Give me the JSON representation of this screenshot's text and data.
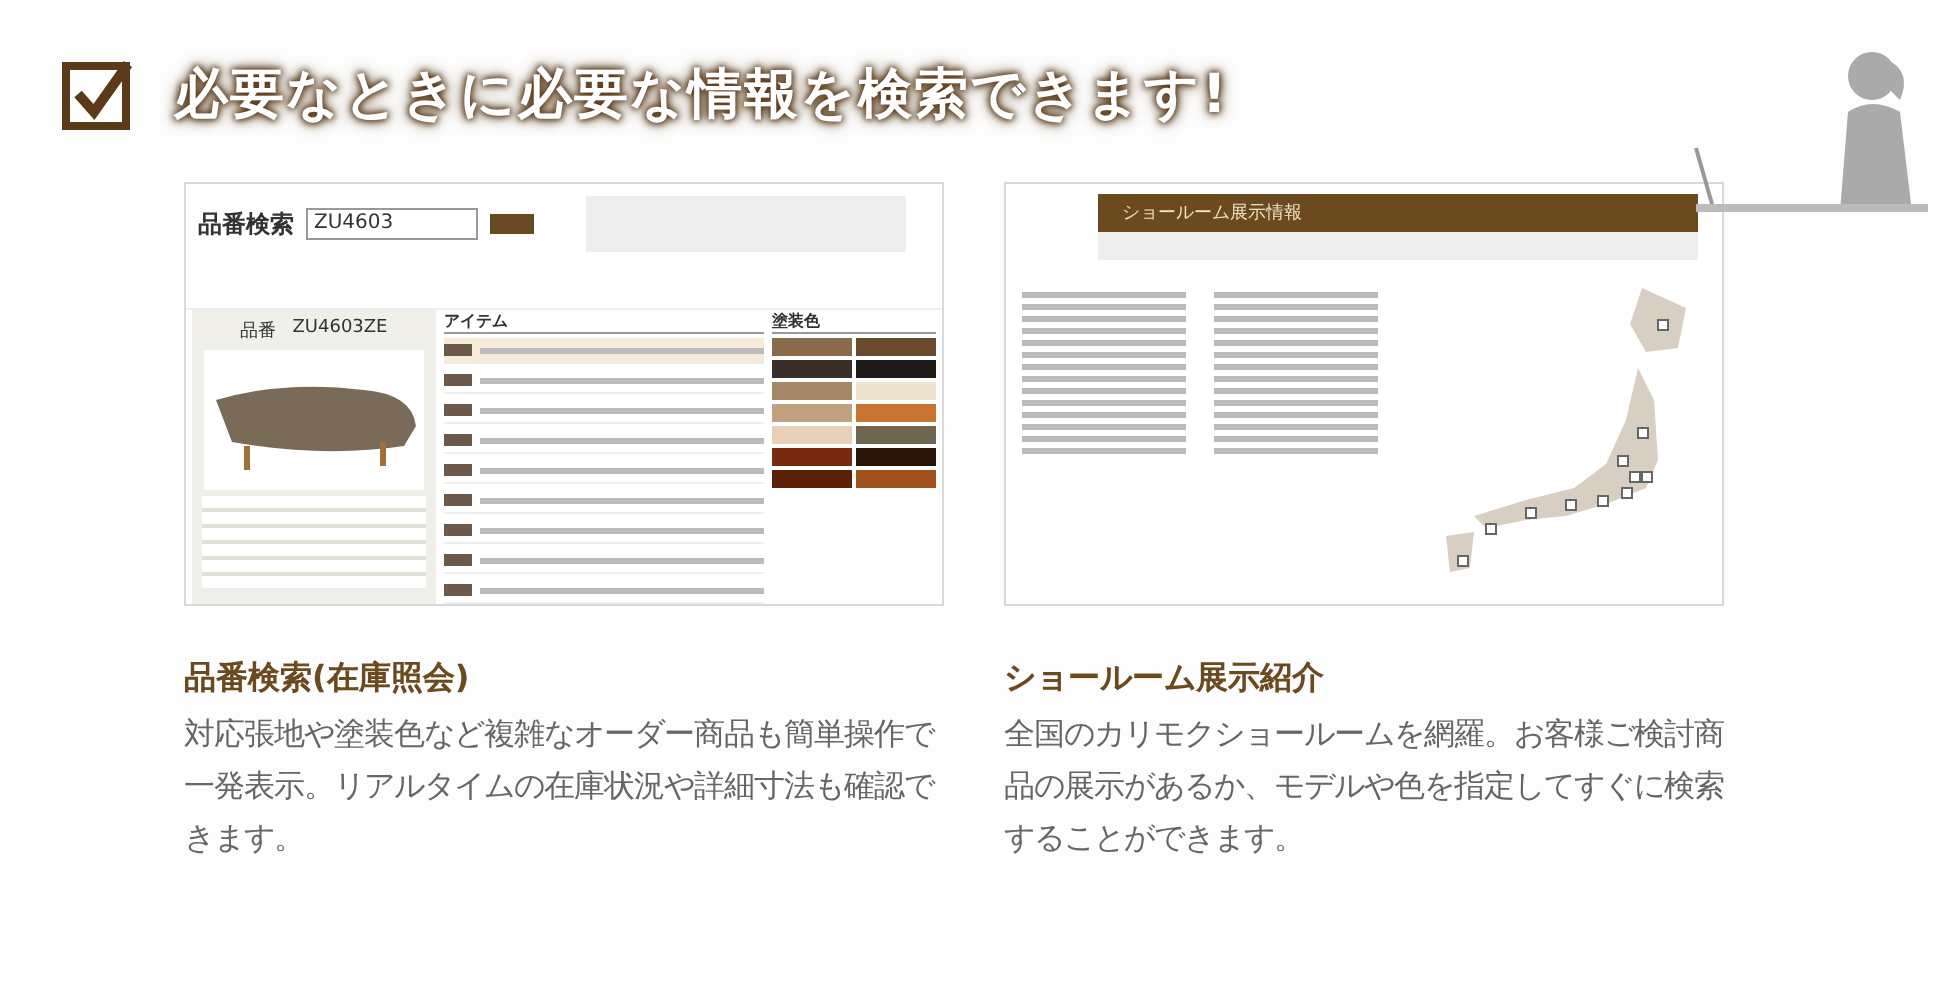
{
  "headline": {
    "checked": true,
    "title": "必要なときに必要な情報を検索できます!"
  },
  "features": [
    {
      "kind": "search",
      "screenshot": {
        "search_label": "品番検索",
        "search_value": "ZU4603",
        "product_label": "品番",
        "product_code": "ZU4603ZE",
        "items_heading": "アイテム",
        "paint_heading": "塗装色"
      },
      "title": "品番検索(在庫照会)",
      "body": "対応張地や塗装色など複雑なオーダー商品も簡単操作で一発表示。リアルタイムの在庫状況や詳細寸法も確認できます。"
    },
    {
      "kind": "showroom",
      "screenshot": {
        "header": "ショールーム展示情報"
      },
      "title": "ショールーム展示紹介",
      "body": "全国のカリモクショールームを網羅。お客様ご検討商品の展示があるか、モデルや色を指定してすぐに検索することができます。"
    }
  ]
}
